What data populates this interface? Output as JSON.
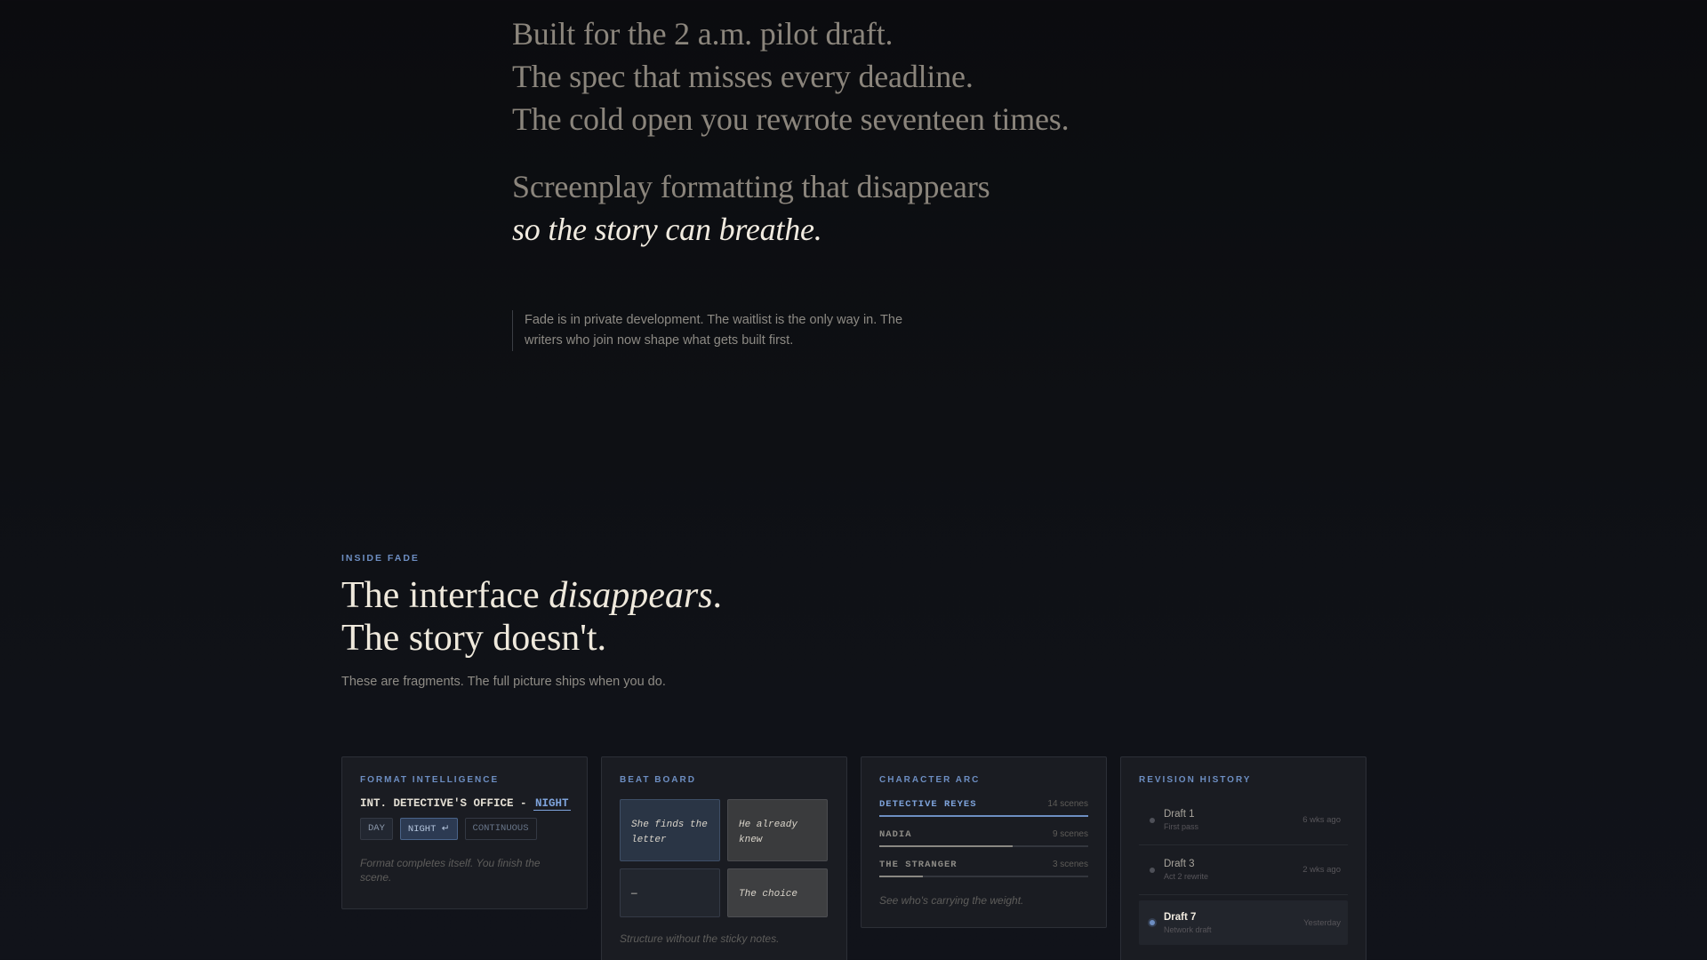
{
  "hero": {
    "lines": [
      "Built for the 2 a.m. pilot draft.",
      "The spec that misses every deadline.",
      "The cold open you rewrote seventeen times."
    ],
    "statement": "Screenplay formatting that disappears",
    "statement_italic": "so the story can breathe."
  },
  "note": {
    "text": "Fade is in private development. The waitlist is the only way in. The writers who join now shape what gets built first."
  },
  "inside": {
    "eyebrow": "INSIDE FADE",
    "headline_pre": "The interface ",
    "headline_italic": "disappears",
    "headline_post": ".",
    "headline_line2": "The story doesn't.",
    "subtitle": "These are fragments. The full picture ships when you do."
  },
  "cards": {
    "format": {
      "title": "FORMAT INTELLIGENCE",
      "slug_prefix": "INT. DETECTIVE'S OFFICE - ",
      "slug_highlight": "NIGHT",
      "options": [
        "DAY",
        "NIGHT ↵",
        "CONTINUOUS"
      ],
      "selected": "NIGHT ↵",
      "caption": "Format completes itself. You finish the scene."
    },
    "beats": {
      "title": "BEAT BOARD",
      "cards": [
        "She finds the letter",
        "He already knew",
        "—",
        "The choice"
      ],
      "caption": "Structure without the sticky notes."
    },
    "arc": {
      "title": "CHARACTER ARC",
      "characters": [
        {
          "name": "DETECTIVE REYES",
          "scenes": "14 scenes",
          "share": 1.0,
          "active": true
        },
        {
          "name": "NADIA",
          "scenes": "9 scenes",
          "share": 0.64,
          "active": false
        },
        {
          "name": "THE STRANGER",
          "scenes": "3 scenes",
          "share": 0.21,
          "active": false
        }
      ],
      "caption": "See who's carrying the weight."
    },
    "revisions": {
      "title": "REVISION HISTORY",
      "items": [
        {
          "name": "Draft 1",
          "note": "First pass",
          "time": "6 wks ago",
          "current": false
        },
        {
          "name": "Draft 3",
          "note": "Act 2 rewrite",
          "time": "2 wks ago",
          "current": false
        },
        {
          "name": "Draft 7",
          "note": "Network draft",
          "time": "Yesterday",
          "current": true
        }
      ]
    }
  },
  "colors": {
    "accent": "#6d8ec2",
    "background": "#0e1014",
    "text": "#efe9dc"
  }
}
